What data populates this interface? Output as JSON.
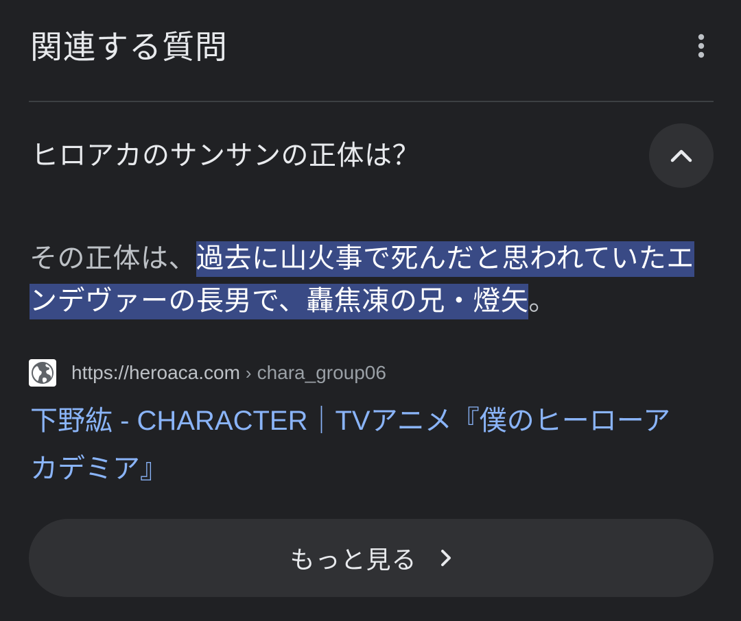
{
  "header": {
    "title": "関連する質問",
    "more_icon": "more-vert-icon"
  },
  "question": {
    "text": "ヒロアカのサンサンの正体は？",
    "toggle_icon": "chevron-up-icon",
    "expanded": true
  },
  "answer": {
    "prefix": "その正体は、",
    "highlighted": "過去に山火事で死んだと思われていたエンデヴァーの長男で、轟焦凍の兄・燈矢",
    "suffix": "。"
  },
  "source": {
    "favicon_icon": "globe-icon",
    "url": "https://heroaca.com",
    "separator": "›",
    "path": "chara_group06"
  },
  "result_link": {
    "title": "下野紘 - CHARACTER｜TVアニメ『僕のヒーローアカデミア』"
  },
  "see_more": {
    "label": "もっと見る",
    "icon": "chevron-right-icon"
  },
  "colors": {
    "background": "#202124",
    "link": "#8ab4f8",
    "highlight": "#394a85",
    "button_bg": "#303134"
  }
}
